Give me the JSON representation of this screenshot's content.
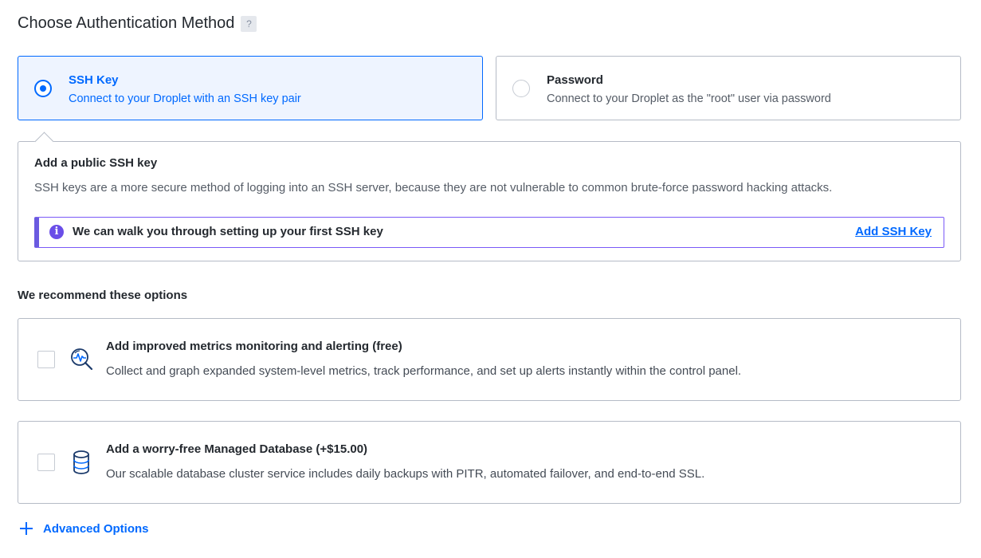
{
  "header": {
    "title": "Choose Authentication Method",
    "help_label": "?"
  },
  "auth_options": [
    {
      "title": "SSH Key",
      "description": "Connect to your Droplet with an SSH key pair",
      "selected": true
    },
    {
      "title": "Password",
      "description": "Connect to your Droplet as the \"root\" user via password",
      "selected": false
    }
  ],
  "ssh_panel": {
    "heading": "Add a public SSH key",
    "body": "SSH keys are a more secure method of logging into an SSH server, because they are not vulnerable to common brute-force password hacking attacks.",
    "info": {
      "icon_glyph": "i",
      "text": "We can walk you through setting up your first SSH key",
      "link_label": "Add SSH Key"
    }
  },
  "recommend": {
    "title": "We recommend these options",
    "options": [
      {
        "title": "Add improved metrics monitoring and alerting (free)",
        "description": "Collect and graph expanded system-level metrics, track performance, and set up alerts instantly within the control panel.",
        "icon": "metrics-icon",
        "checked": false
      },
      {
        "title": "Add a worry-free Managed Database (+$15.00)",
        "description": "Our scalable database cluster service includes daily backups with PITR, automated failover, and end-to-end SSL.",
        "icon": "database-icon",
        "checked": false
      }
    ]
  },
  "advanced": {
    "label": "Advanced Options"
  },
  "colors": {
    "accent": "#0069ff",
    "info_accent": "#6a4ee8",
    "border": "#b5bbc6",
    "selected_bg": "#eef4ff"
  }
}
